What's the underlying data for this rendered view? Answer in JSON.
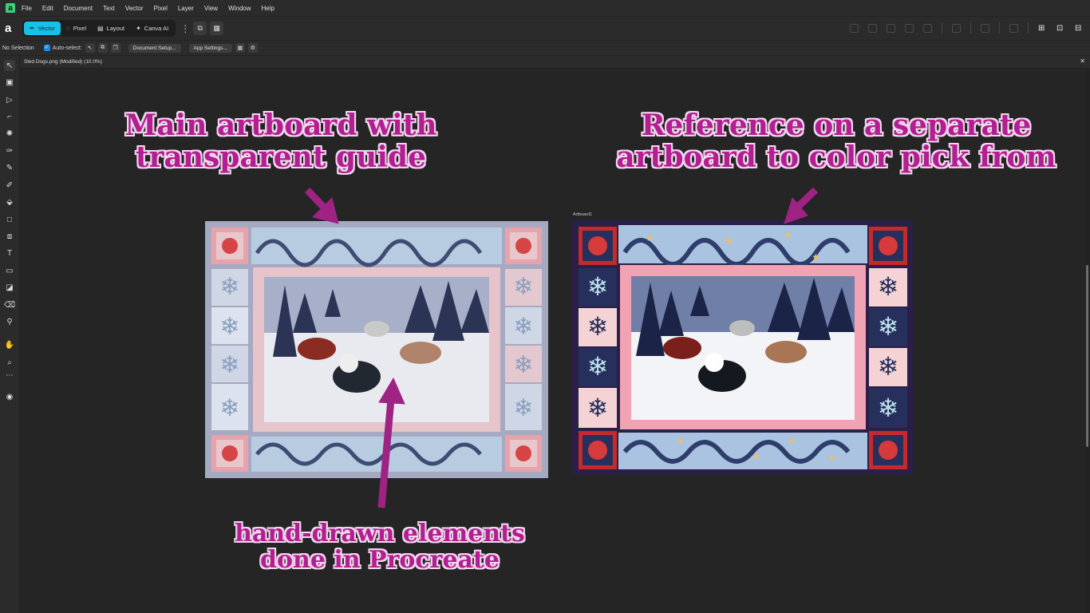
{
  "menubar": {
    "items": [
      "File",
      "Edit",
      "Document",
      "Text",
      "Vector",
      "Pixel",
      "Layer",
      "View",
      "Window",
      "Help"
    ]
  },
  "toolbar": {
    "personas": [
      {
        "label": "Vector",
        "icon": "vector-persona-icon",
        "active": true
      },
      {
        "label": "Pixel",
        "icon": "pixel-persona-icon",
        "active": false
      },
      {
        "label": "Layout",
        "icon": "layout-persona-icon",
        "active": false
      },
      {
        "label": "Canva AI",
        "icon": "canva-ai-icon",
        "active": false
      }
    ]
  },
  "secondary": {
    "selection": "No Selection",
    "auto_select": "Auto-select:",
    "document_setup": "Document Setup...",
    "app_settings": "App Settings..."
  },
  "document": {
    "tab_title": "Sled Dogs.png (Modified) (10.0%)",
    "artboard_label": "Artboard1"
  },
  "annotations": {
    "main_title_line1": "Main artboard with",
    "main_title_line2": "transparent guide",
    "reference_line1": "Reference on a separate",
    "reference_line2": "artboard to color pick from",
    "handdrawn_line1": "hand-drawn elements",
    "handdrawn_line2": "done in Procreate"
  },
  "colors": {
    "accent": "#16c0e6",
    "annotation_text": "#b31e90",
    "annotation_outline": "#f0d9ee",
    "arrow": "#9e2383",
    "reference_border": "#2a1f47"
  }
}
